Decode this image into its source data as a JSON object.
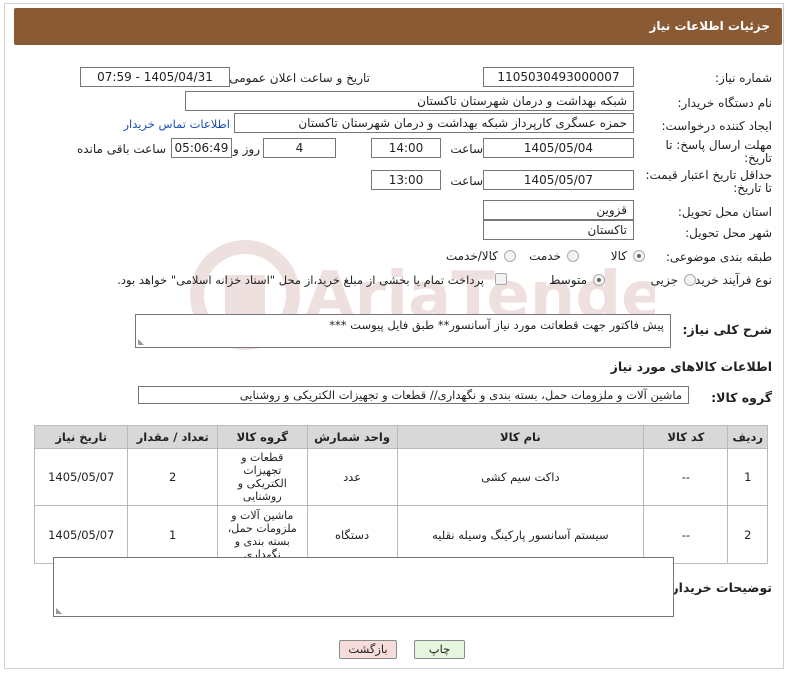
{
  "header": {
    "title": "جزئیات اطلاعات نیاز"
  },
  "fields": {
    "need_number_label": "شماره نیاز:",
    "need_number": "1105030493000007",
    "announce_label": "تاریخ و ساعت اعلان عمومی:",
    "announce_value": "1405/04/31 - 07:59",
    "buyer_org_label": "نام دستگاه خریدار:",
    "buyer_org": "شبکه بهداشت و درمان شهرستان تاکستان",
    "creator_label": "ایجاد کننده درخواست:",
    "creator": "حمزه عسگری کارپرداز شبکه بهداشت و درمان شهرستان تاکستان",
    "contact_link": "اطلاعات تماس خریدار",
    "deadline_label_1": "مهلت ارسال پاسخ: تا",
    "deadline_label_2": "تاریخ:",
    "deadline_date": "1405/05/04",
    "time_label": "ساعت",
    "deadline_time": "14:00",
    "days_value": "4",
    "days_label": "روز و",
    "remaining_time": "05:06:49",
    "remaining_label": "ساعت باقی مانده",
    "price_valid_label_1": "حداقل تاریخ اعتبار قیمت:",
    "price_valid_label_2": "تا تاریخ:",
    "price_valid_date": "1405/05/07",
    "price_valid_time": "13:00",
    "province_label": "استان محل تحویل:",
    "province": "قزوین",
    "city_label": "شهر محل تحویل:",
    "city": "تاکستان",
    "category_label": "طبقه بندی موضوعی:",
    "category_options": [
      "کالا",
      "خدمت",
      "کالا/خدمت"
    ],
    "category_selected": "کالا",
    "process_label": "نوع فرآیند خرید :",
    "process_options": [
      "جزیی",
      "متوسط"
    ],
    "process_selected": "متوسط",
    "payment_note": "پرداخت تمام یا بخشی از مبلغ خرید،از محل \"اسناد خزانه اسلامی\" خواهد بود."
  },
  "description": {
    "label": "شرح کلی نیاز:",
    "text": "پیش فاکتور جهت قطعاتت مورد نیاز  آسانسور** طبق فایل پیوست ***"
  },
  "goods": {
    "section_title": "اطلاعات کالاهای مورد نیاز",
    "group_label": "گروه کالا:",
    "group_value": "ماشین آلات و ملزومات حمل، بسته بندی و نگهداری// قطعات و تجهیزات الکتریکی و روشنایی",
    "columns": [
      "ردیف",
      "کد کالا",
      "نام کالا",
      "واحد شمارش",
      "گروه کالا",
      "تعداد / مقدار",
      "تاریخ نیاز"
    ],
    "rows": [
      {
        "row": "1",
        "code": "--",
        "name": "داکت سیم کشی",
        "unit": "عدد",
        "group": "قطعات و تجهیزات الکتریکی و روشنایی",
        "qty": "2",
        "date": "1405/05/07"
      },
      {
        "row": "2",
        "code": "--",
        "name": "سیستم آسانسور پارکینگ وسیله نقلیه",
        "unit": "دستگاه",
        "group": "ماشین آلات و ملزومات حمل، بسته بندی و نگهداری",
        "qty": "1",
        "date": "1405/05/07"
      }
    ]
  },
  "buyer_notes": {
    "label": "توضیحات خریدار:",
    "text": ""
  },
  "buttons": {
    "print": "چاپ",
    "back": "بازگشت"
  },
  "watermark": {
    "text": "AriaTender.net"
  },
  "colors": {
    "header": "#8a5a35",
    "print_btn": "#e6f5dd",
    "back_btn": "#f7dcdc",
    "link": "#1a4fb5"
  }
}
